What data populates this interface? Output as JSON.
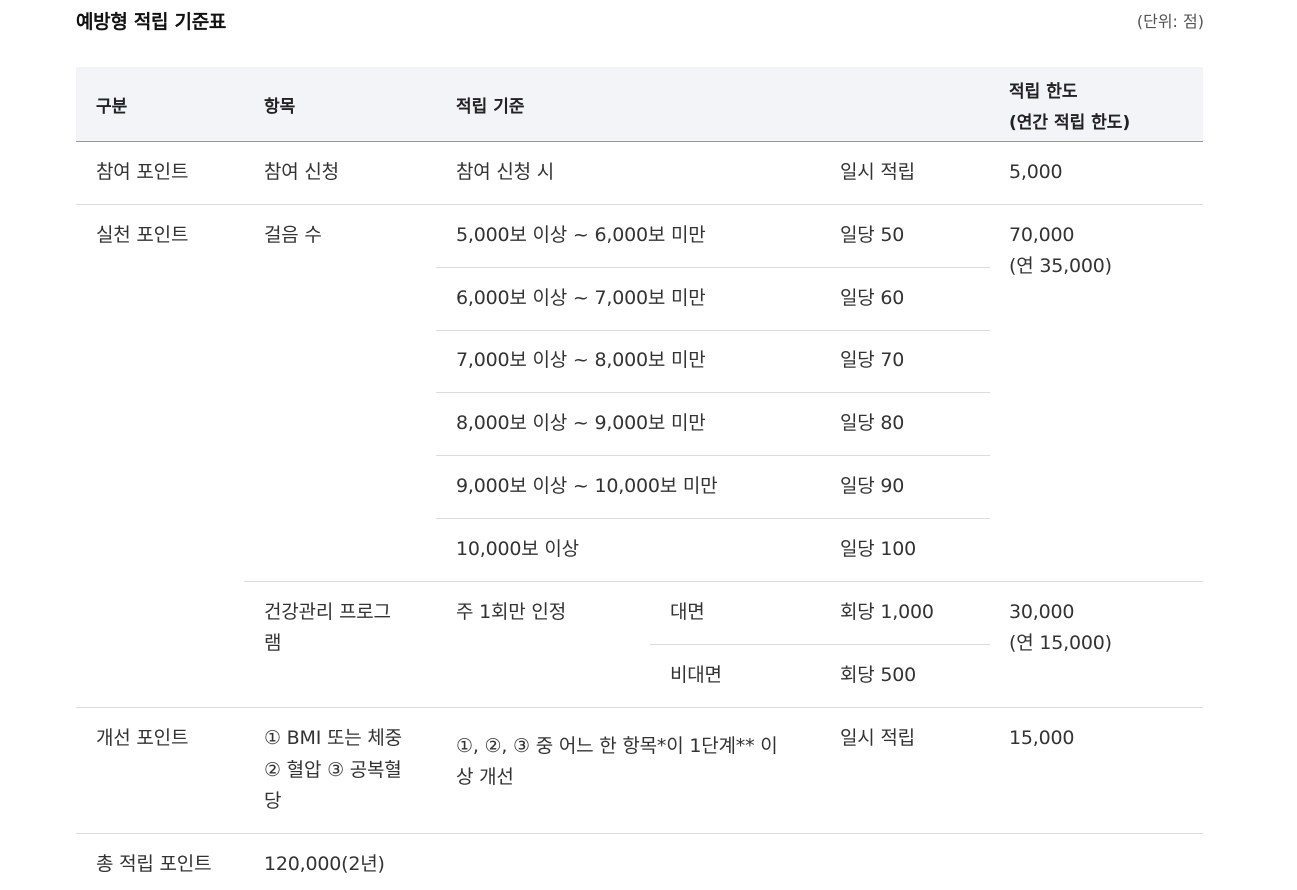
{
  "title": "예방형 적립 기준표",
  "unit": "(단위: 점)",
  "header": {
    "category": "구분",
    "item": "항목",
    "criteria": "적립 기준",
    "limit_line1": "적립 한도",
    "limit_line2": "(연간 적립 한도)"
  },
  "rows": {
    "participation": {
      "category": "참여 포인트",
      "item": "참여 신청",
      "criteria": "참여 신청 시",
      "rate": "일시 적립",
      "limit": "5,000"
    },
    "practice": {
      "category": "실천 포인트",
      "steps": {
        "item": "걸음 수",
        "tiers": [
          {
            "criteria": "5,000보 이상 ~ 6,000보 미만",
            "rate": "일당 50"
          },
          {
            "criteria": "6,000보 이상 ~ 7,000보 미만",
            "rate": "일당 60"
          },
          {
            "criteria": "7,000보 이상 ~ 8,000보 미만",
            "rate": "일당 70"
          },
          {
            "criteria": "8,000보 이상 ~ 9,000보 미만",
            "rate": "일당 80"
          },
          {
            "criteria": "9,000보 이상 ~ 10,000보 미만",
            "rate": "일당 90"
          },
          {
            "criteria": "10,000보 이상",
            "rate": "일당 100"
          }
        ],
        "limit_line1": "70,000",
        "limit_line2": "(연 35,000)"
      },
      "program": {
        "item_line1": "건강관리 프로그",
        "item_line2": "램",
        "criteria": "주 1회만 인정",
        "modes": [
          {
            "mode": "대면",
            "rate": "회당 1,000"
          },
          {
            "mode": "비대면",
            "rate": "회당 500"
          }
        ],
        "limit_line1": "30,000",
        "limit_line2": "(연 15,000)"
      }
    },
    "improvement": {
      "category": "개선 포인트",
      "item_line1": "① BMI 또는 체중",
      "item_line2": "② 혈압 ③ 공복혈",
      "item_line3": "당",
      "criteria_line1": "①, ②, ③ 중 어느 한 항목*이 1단계** 이",
      "criteria_line2": "상 개선",
      "rate": "일시 적립",
      "limit": "15,000"
    },
    "total": {
      "category": "총 적립 포인트",
      "value": "120,000(2년)"
    }
  }
}
